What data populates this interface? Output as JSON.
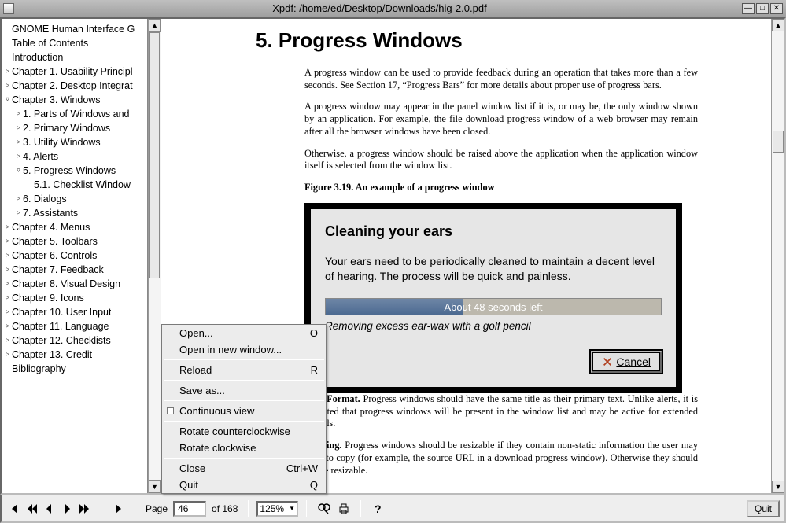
{
  "titlebar": {
    "text": "Xpdf: /home/ed/Desktop/Downloads/hig-2.0.pdf"
  },
  "outline": {
    "items": [
      {
        "label": "GNOME Human Interface G",
        "tw": "",
        "indent": 0
      },
      {
        "label": "Table of Contents",
        "tw": "",
        "indent": 0
      },
      {
        "label": "Introduction",
        "tw": "",
        "indent": 0
      },
      {
        "label": "Chapter 1. Usability Principl",
        "tw": "▹",
        "indent": 0
      },
      {
        "label": "Chapter 2. Desktop Integrat",
        "tw": "▹",
        "indent": 0
      },
      {
        "label": "Chapter 3. Windows",
        "tw": "▿",
        "indent": 0
      },
      {
        "label": "1. Parts of Windows and",
        "tw": "▹",
        "indent": 1
      },
      {
        "label": "2. Primary Windows",
        "tw": "▹",
        "indent": 1
      },
      {
        "label": "3. Utility Windows",
        "tw": "▹",
        "indent": 1
      },
      {
        "label": "4. Alerts",
        "tw": "▹",
        "indent": 1
      },
      {
        "label": "5. Progress Windows",
        "tw": "▿",
        "indent": 1
      },
      {
        "label": "5.1. Checklist Window",
        "tw": "",
        "indent": 2
      },
      {
        "label": "6. Dialogs",
        "tw": "▹",
        "indent": 1
      },
      {
        "label": "7. Assistants",
        "tw": "▹",
        "indent": 1
      },
      {
        "label": "Chapter 4. Menus",
        "tw": "▹",
        "indent": 0
      },
      {
        "label": "Chapter 5. Toolbars",
        "tw": "▹",
        "indent": 0
      },
      {
        "label": "Chapter 6. Controls",
        "tw": "▹",
        "indent": 0
      },
      {
        "label": "Chapter 7. Feedback",
        "tw": "▹",
        "indent": 0
      },
      {
        "label": "Chapter 8. Visual Design",
        "tw": "▹",
        "indent": 0
      },
      {
        "label": "Chapter 9. Icons",
        "tw": "▹",
        "indent": 0
      },
      {
        "label": "Chapter 10. User Input",
        "tw": "▹",
        "indent": 0
      },
      {
        "label": "Chapter 11. Language",
        "tw": "▹",
        "indent": 0
      },
      {
        "label": "Chapter 12. Checklists",
        "tw": "▹",
        "indent": 0
      },
      {
        "label": "Chapter 13. Credit",
        "tw": "▹",
        "indent": 0
      },
      {
        "label": "Bibliography",
        "tw": "",
        "indent": 0
      }
    ]
  },
  "doc": {
    "heading": "5. Progress Windows",
    "p1": "A progress window can be used to provide feedback during an operation that takes more than a few seconds. See Section 17, “Progress Bars” for more details about proper use of progress bars.",
    "p2": "A progress window may appear in the panel window list if it is, or may be, the only window shown by an application. For example, the file download progress window of a web browser may remain after all the browser windows have been closed.",
    "p3": "Otherwise, a progress window should be raised above the application when the application window itself is selected from the window list.",
    "figcap": "Figure 3.19. An example of a progress window",
    "example": {
      "title": "Cleaning your ears",
      "body": "Your ears need to be periodically cleaned to maintain a decent level of hearing. The process will be quick and painless.",
      "progress_text": "About 48 seconds left",
      "status": "Removing excess ear-wax with a golf pencil",
      "cancel": "Cancel"
    },
    "b1_lead": "Title Format.",
    "b1": " Progress windows should have the same title as their primary text. Unlike alerts, it is expected that progress windows will be present in the window list and may be active for extended periods.",
    "b2_lead": "Resizing.",
    "b2": " Progress windows should be resizable if they contain non-static information the user may want to copy (for example, the source URL in a download progress window). Otherwise they should not be resizable."
  },
  "context_menu": {
    "items": [
      {
        "label": "Open...",
        "accel": "O"
      },
      {
        "label": "Open in new window...",
        "accel": ""
      },
      {
        "sep": true
      },
      {
        "label": "Reload",
        "accel": "R"
      },
      {
        "sep": true
      },
      {
        "label": "Save as...",
        "accel": ""
      },
      {
        "sep": true
      },
      {
        "label": "Continuous view",
        "accel": "",
        "check": true
      },
      {
        "sep": true
      },
      {
        "label": "Rotate counterclockwise",
        "accel": ""
      },
      {
        "label": "Rotate clockwise",
        "accel": ""
      },
      {
        "sep": true
      },
      {
        "label": "Close",
        "accel": "Ctrl+W"
      },
      {
        "label": "Quit",
        "accel": "Q"
      }
    ]
  },
  "toolbar": {
    "page_label": "Page",
    "page_value": "46",
    "page_total": "of 168",
    "zoom": "125%",
    "quit": "Quit"
  }
}
